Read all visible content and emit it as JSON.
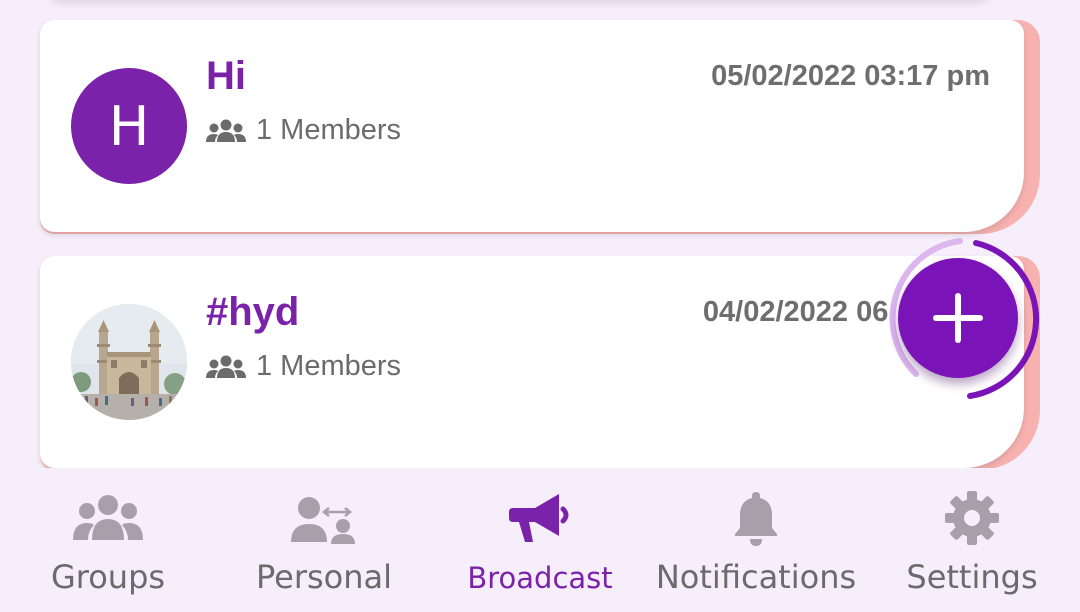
{
  "groups": [
    {
      "name": "Hi",
      "avatar_letter": "H",
      "members_text": "1 Members",
      "timestamp": "05/02/2022 03:17 pm"
    },
    {
      "name": "#hyd",
      "avatar_letter": "",
      "members_text": "1 Members",
      "timestamp": "04/02/2022 06:"
    }
  ],
  "fab": {
    "icon": "plus-icon"
  },
  "bottom_nav": {
    "items": [
      {
        "label": "Groups",
        "icon": "groups-icon"
      },
      {
        "label": "Personal",
        "icon": "personal-icon"
      },
      {
        "label": "Broadcast",
        "icon": "megaphone-icon"
      },
      {
        "label": "Notifications",
        "icon": "bell-icon"
      },
      {
        "label": "Settings",
        "icon": "gear-icon"
      }
    ],
    "active": "Broadcast"
  },
  "colors": {
    "accent": "#7b22ab",
    "card_edge": "#f7b2b0",
    "background": "#f6eefb",
    "inactive": "#a7a0ab"
  }
}
